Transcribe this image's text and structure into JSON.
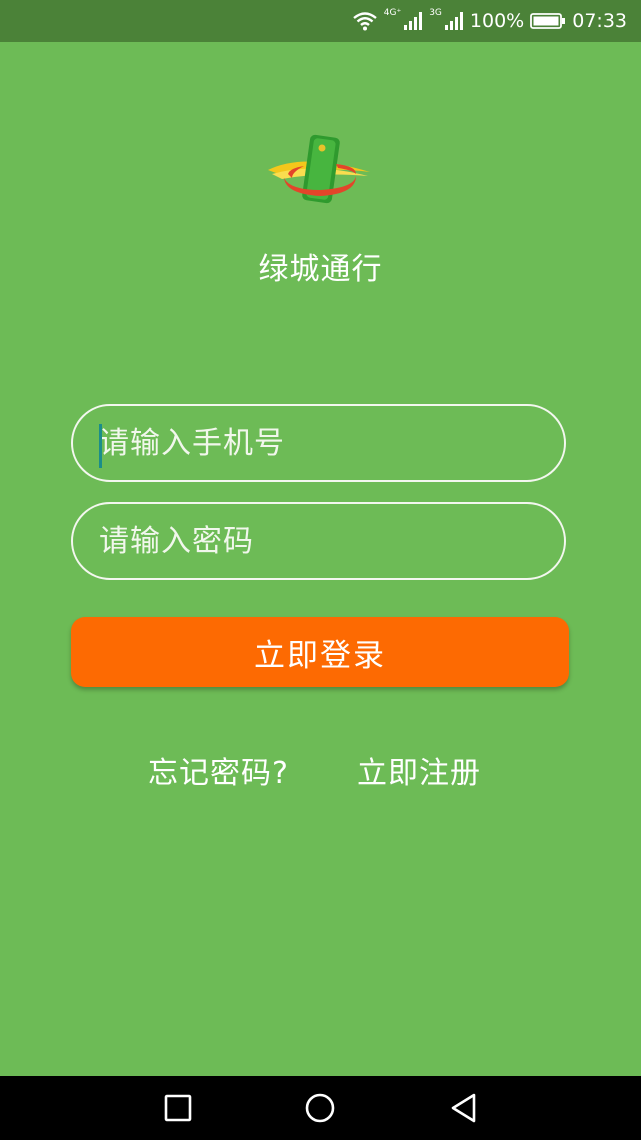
{
  "status_bar": {
    "network_4g": "4G⁺",
    "network_3g": "3G",
    "battery_percent": "100%",
    "time": "07:33"
  },
  "app": {
    "title": "绿城通行"
  },
  "login_form": {
    "phone_placeholder": "请输入手机号",
    "phone_value": "",
    "password_placeholder": "请输入密码",
    "password_value": "",
    "login_button_label": "立即登录"
  },
  "links": {
    "forgot_password": "忘记密码?",
    "register": "立即注册"
  },
  "colors": {
    "background": "#6dbb56",
    "status_bar": "#4b8238",
    "accent_button": "#fd6a02",
    "caret": "#1b8d8a"
  },
  "icons": {
    "wifi": "wifi-icon",
    "signal_1": "signal-icon",
    "signal_2": "signal-icon",
    "battery": "battery-icon",
    "nav_recent": "square-icon",
    "nav_home": "circle-icon",
    "nav_back": "triangle-back-icon"
  }
}
